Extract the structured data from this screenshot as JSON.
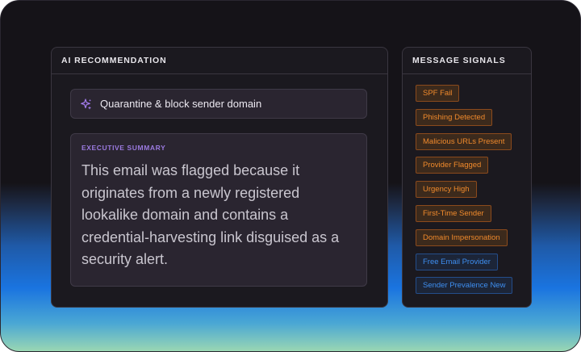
{
  "left_panel": {
    "title": "AI RECOMMENDATION",
    "recommendation": {
      "icon": "sparkle-icon",
      "text": "Quarantine & block sender domain"
    },
    "summary": {
      "label": "EXECUTIVE SUMMARY",
      "text": "This email was flagged because it originates from a newly registered lookalike domain and contains a credential-harvesting link disguised as a security alert."
    }
  },
  "right_panel": {
    "title": "MESSAGE SIGNALS",
    "signals": [
      {
        "label": "SPF Fail",
        "kind": "warn"
      },
      {
        "label": "Phishing Detected",
        "kind": "warn"
      },
      {
        "label": "Malicious URLs Present",
        "kind": "warn"
      },
      {
        "label": "Provider Flagged",
        "kind": "warn"
      },
      {
        "label": "Urgency High",
        "kind": "warn"
      },
      {
        "label": "First-Time Sender",
        "kind": "warn"
      },
      {
        "label": "Domain Impersonation",
        "kind": "warn"
      },
      {
        "label": "Free Email Provider",
        "kind": "info"
      },
      {
        "label": "Sender Prevalence New",
        "kind": "info"
      }
    ]
  },
  "colors": {
    "warn": "#f08a2c",
    "info": "#3e8ef0",
    "accent": "#9b7ae0"
  }
}
